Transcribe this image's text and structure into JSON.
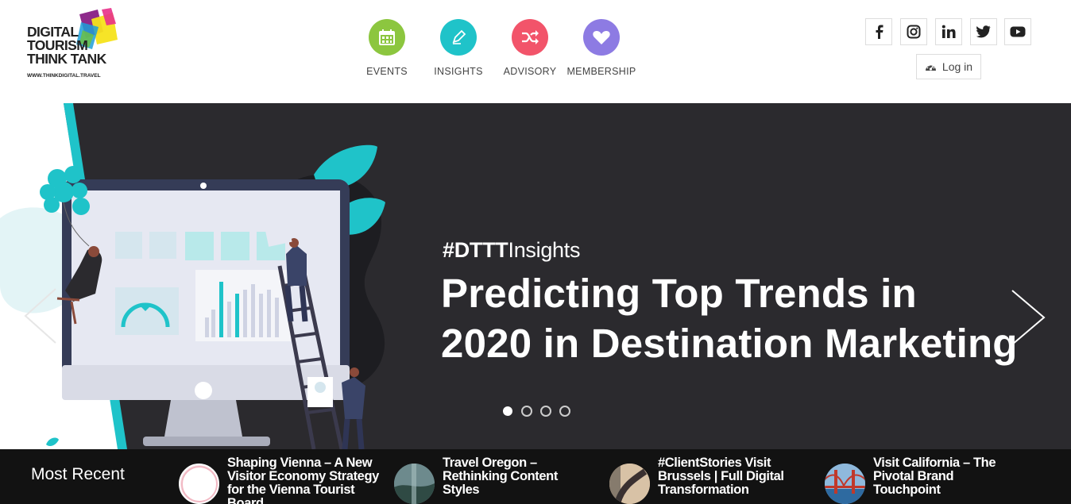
{
  "logo": {
    "lines": [
      "DIGITAL",
      "TOURISM",
      "THINK TANK"
    ],
    "url": "WWW.THINKDIGITAL.TRAVEL"
  },
  "nav": [
    {
      "label": "EVENTS",
      "icon": "calendar-icon",
      "color": "#8cc63f"
    },
    {
      "label": "INSIGHTS",
      "icon": "pencil-icon",
      "color": "#1fc3c9"
    },
    {
      "label": "ADVISORY",
      "icon": "shuffle-icon",
      "color": "#f2546a"
    },
    {
      "label": "MEMBERSHIP",
      "icon": "heart-icon",
      "color": "#8d7be3"
    }
  ],
  "social": [
    {
      "name": "facebook",
      "glyph": "f"
    },
    {
      "name": "instagram",
      "glyph": "◎"
    },
    {
      "name": "linkedin",
      "glyph": "in"
    },
    {
      "name": "twitter",
      "glyph": "t"
    },
    {
      "name": "youtube",
      "glyph": "▶"
    }
  ],
  "login": {
    "label": "Log in",
    "icon": "dashboard-icon"
  },
  "hero": {
    "kicker_bold": "#DTTT",
    "kicker_light": "Insights",
    "title_line1": "Predicting Top Trends in",
    "title_line2": "2020 in Destination Marketing",
    "slide_count": 4,
    "active_slide": 1,
    "colors": {
      "background": "#2b2a2e",
      "accent": "#1fc3c9"
    }
  },
  "recent": {
    "label": "Most Recent",
    "items": [
      {
        "title": "Shaping Vienna – A New Visitor Economy Strategy for the Vienna Tourist Board",
        "thumb_color": "#f2d7dc"
      },
      {
        "title": "Travel Oregon – Rethinking Content Styles",
        "thumb_color": "#4f6f7a"
      },
      {
        "title": "#ClientStories Visit Brussels | Full Digital Transformation",
        "thumb_color": "#c9a27a"
      },
      {
        "title": "Visit California – The Pivotal Brand Touchpoint",
        "thumb_color": "#3a86c8"
      }
    ]
  }
}
